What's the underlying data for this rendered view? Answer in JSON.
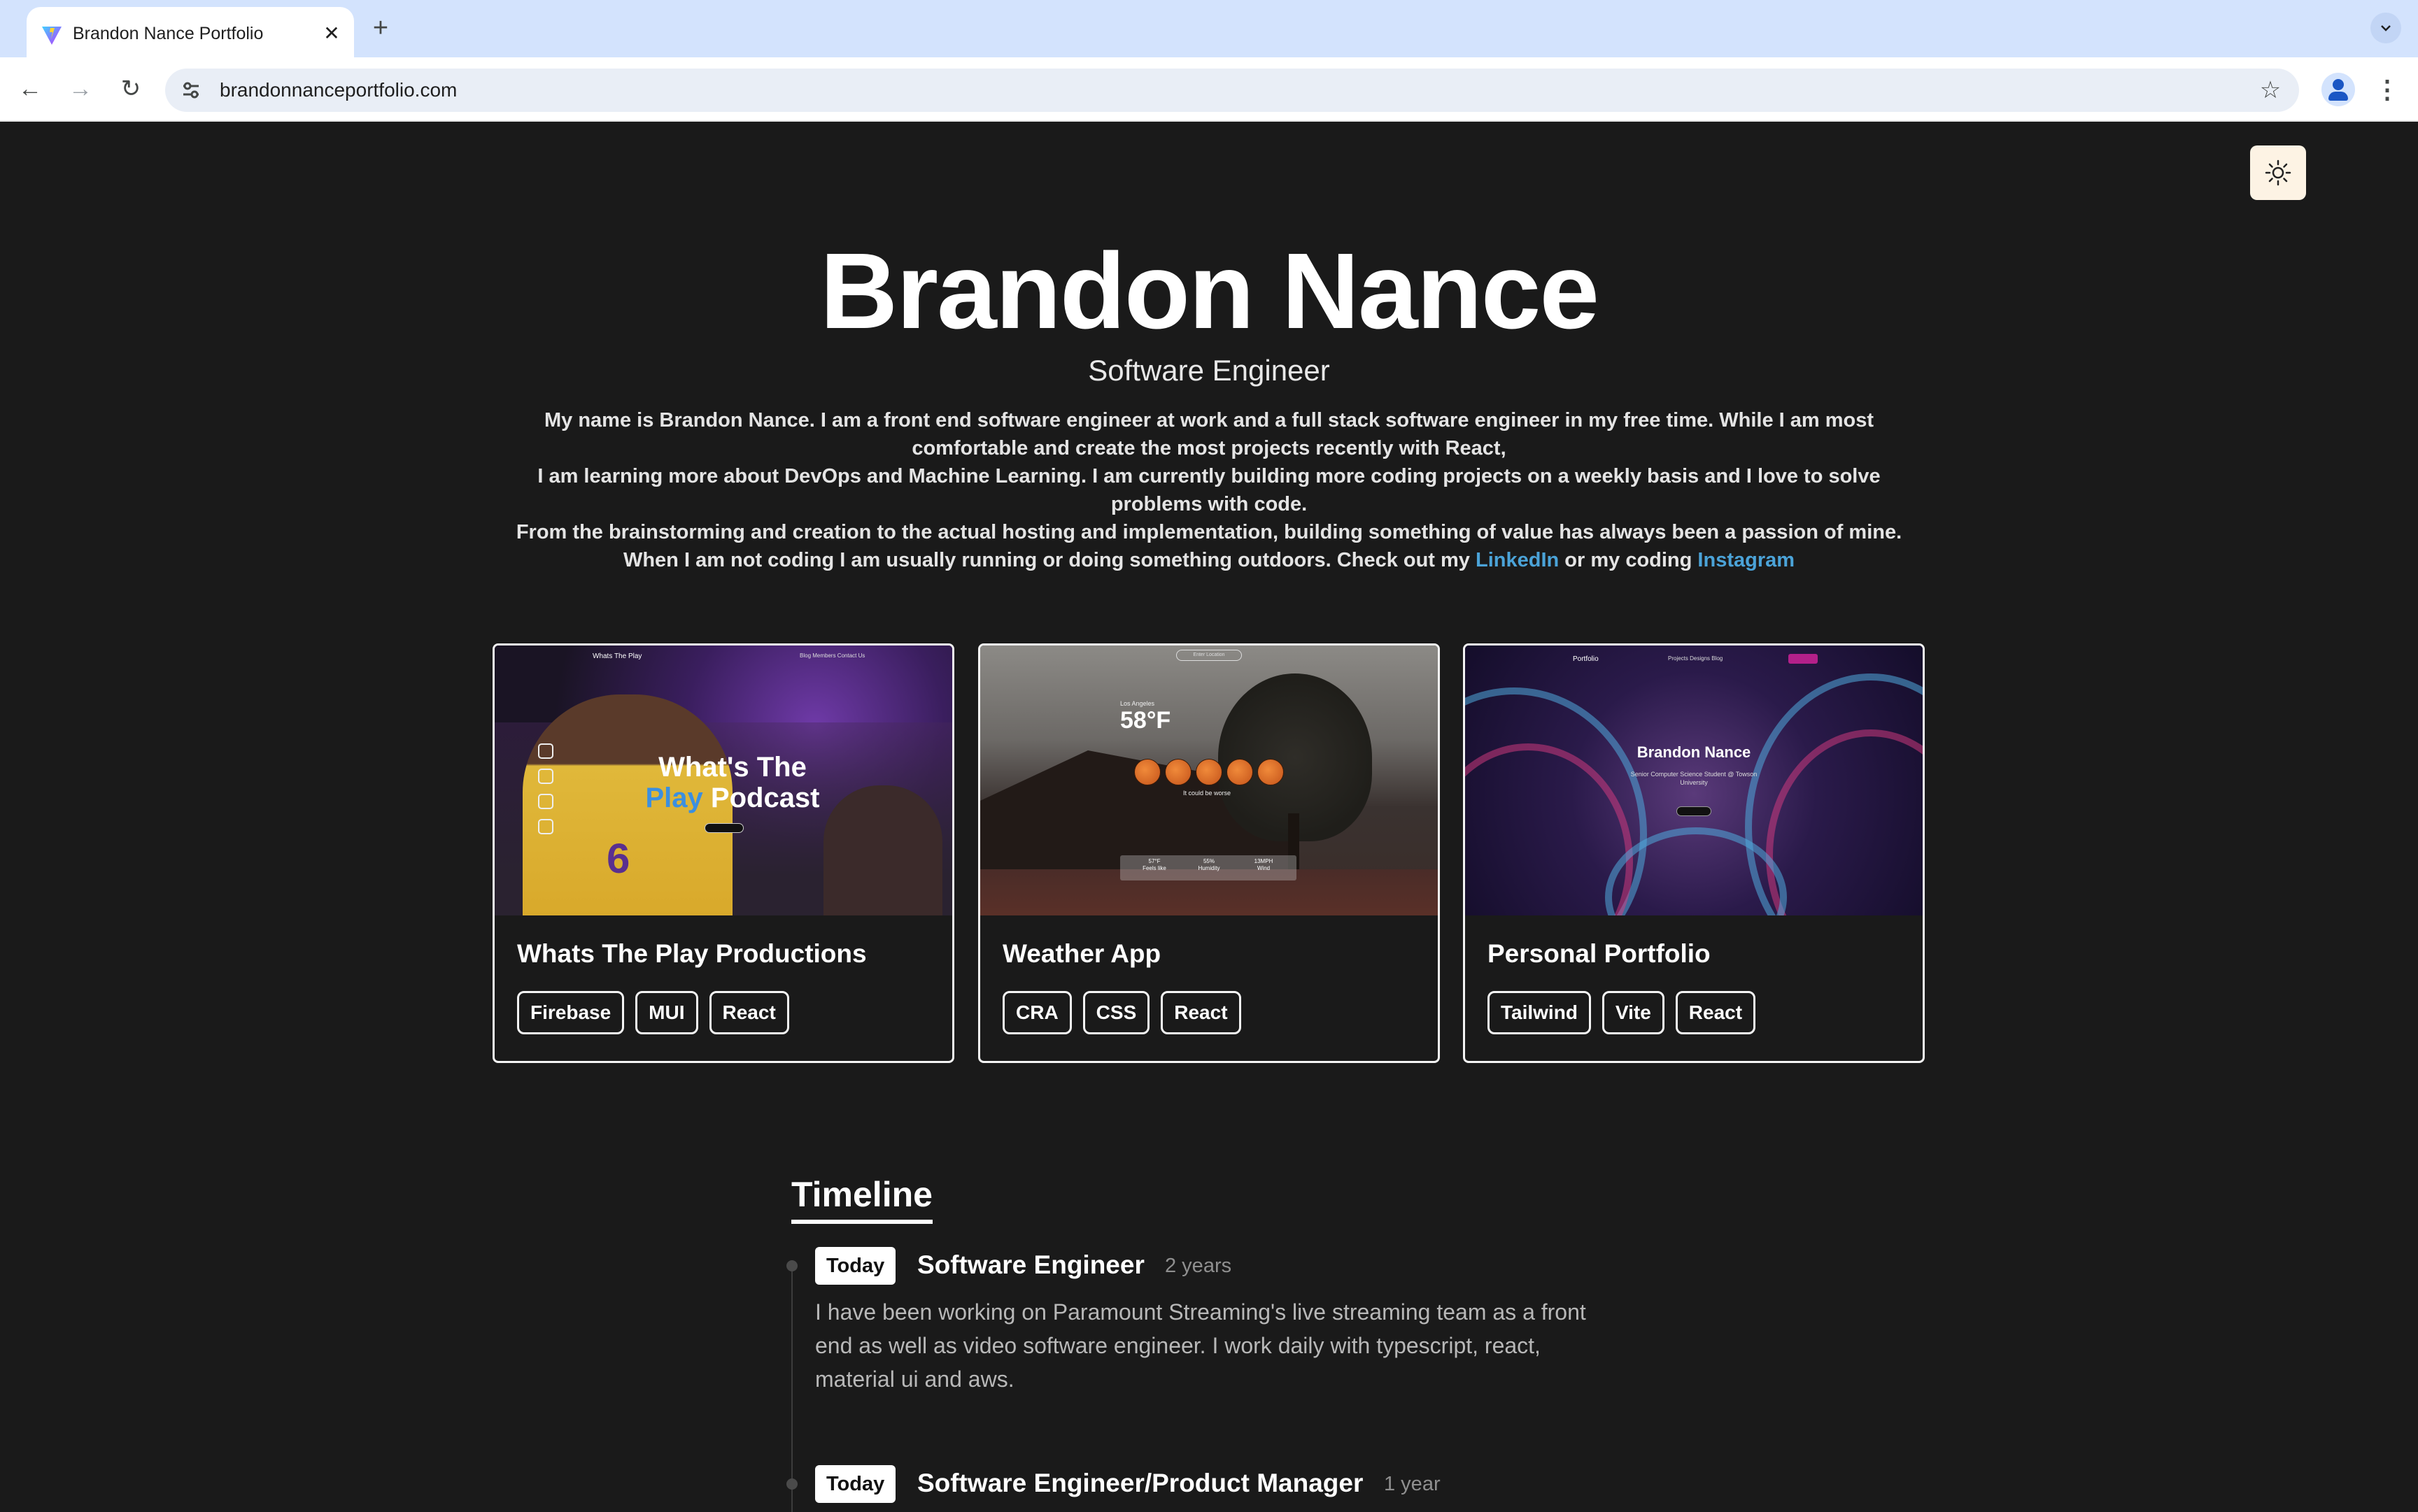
{
  "browser": {
    "tab_title": "Brandon Nance Portfolio",
    "tab_close": "✕",
    "new_tab": "+",
    "tab_search_icon": "chevron-down-icon",
    "url": "brandonnanceportfolio.com",
    "nav": {
      "back": "←",
      "forward": "→",
      "reload": "↻"
    },
    "star": "☆",
    "menu": "⋮"
  },
  "theme_toggle": {
    "icon": "sun-icon"
  },
  "hero": {
    "name": "Brandon Nance",
    "role": "Software Engineer",
    "bio_line1": "My name is Brandon Nance. I am a front end software engineer at work and a full stack software engineer in my free time. While I am most comfortable and create the most projects recently with React,",
    "bio_line2": "I am learning more about DevOps and Machine Learning. I am currently building more coding projects on a weekly basis and I love to solve problems with code.",
    "bio_line3": "From the brainstorming and creation to the actual hosting and implementation, building something of value has always been a passion of mine.",
    "bio_line4_pre": "When I am not coding I am usually running or doing something outdoors. Check out my ",
    "linkedin": "LinkedIn",
    "bio_line4_mid": " or my coding ",
    "instagram": "Instagram",
    "link_color": "#4ba3d8"
  },
  "projects": [
    {
      "title": "Whats The Play Productions",
      "tags": [
        "Firebase",
        "MUI",
        "React"
      ],
      "preview": {
        "brand": "Whats The Play",
        "nav": "Blog   Members   Contact Us",
        "headline_1": "What's The",
        "headline_play": "Play",
        "headline_2": " Podcast",
        "jersey": "6"
      }
    },
    {
      "title": "Weather App",
      "tags": [
        "CRA",
        "CSS",
        "React"
      ],
      "preview": {
        "search": "Enter Location",
        "city": "Los Angeles",
        "temp": "58°F",
        "note": "It could be worse",
        "stats": [
          {
            "value": "57°F",
            "label": "Feels like"
          },
          {
            "value": "55%",
            "label": "Humidity"
          },
          {
            "value": "13MPH",
            "label": "Wind"
          }
        ]
      }
    },
    {
      "title": "Personal Portfolio",
      "tags": [
        "Tailwind",
        "Vite",
        "React"
      ],
      "preview": {
        "brand": "Portfolio",
        "nav": "Projects   Designs   Blog",
        "name": "Brandon Nance",
        "sub": "Senior Computer Science Student @ Towson University"
      }
    }
  ],
  "timeline": {
    "title": "Timeline",
    "entries": [
      {
        "badge": "Today",
        "role": "Software Engineer",
        "duration": "2 years",
        "description": "I have been working on Paramount Streaming's live streaming team as a front end as well as video software engineer. I work daily with typescript, react, material ui and aws."
      },
      {
        "badge": "Today",
        "role": "Software Engineer/Product Manager",
        "duration": "1 year"
      }
    ]
  },
  "colors": {
    "page_bg": "#1a1a1a",
    "tabbar_bg": "#d3e3fd",
    "toggle_bg": "#fdf3e4",
    "accent_blue": "#3b8fe0"
  }
}
